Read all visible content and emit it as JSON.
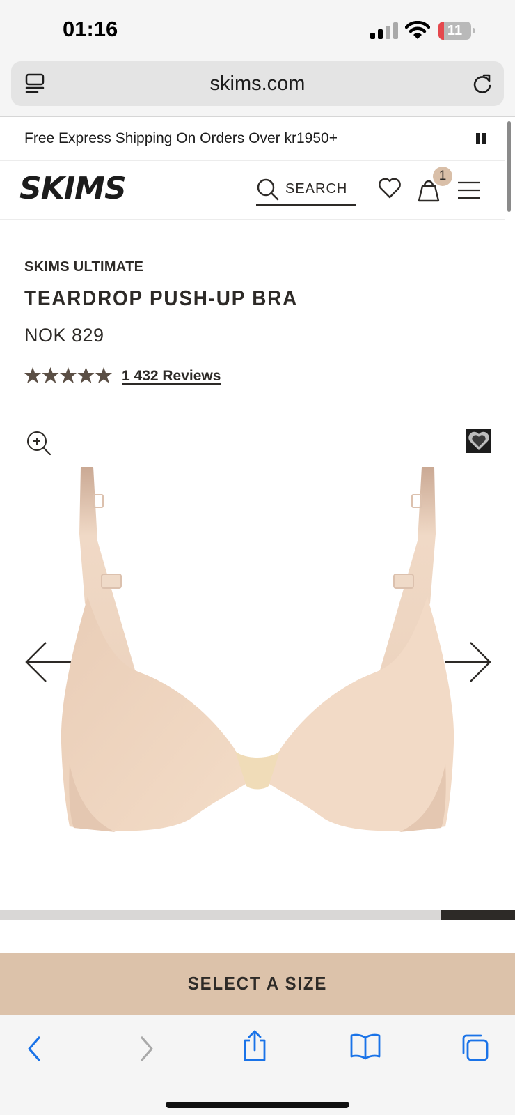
{
  "status_bar": {
    "time": "01:16",
    "battery": "11",
    "battery_level": 0.11
  },
  "browser": {
    "url": "skims.com"
  },
  "promo": {
    "text": "Free Express Shipping On Orders Over kr1950+"
  },
  "header": {
    "logo": "SKIMS",
    "search_label": "SEARCH",
    "cart_count": "1"
  },
  "product": {
    "collection": "SKIMS ULTIMATE",
    "title": "TEARDROP PUSH-UP BRA",
    "price": "NOK 829",
    "rating": 5,
    "reviews": "1 432 Reviews"
  },
  "gallery": {
    "image": "nude-push-up-bra",
    "progress_start": 0.857,
    "progress_end": 1.0
  },
  "cta": {
    "select_size": "SELECT A SIZE"
  },
  "colors": {
    "accent": "#dcc2aa",
    "text": "#2d2a27",
    "ios_blue": "#1a73e8"
  },
  "icons": {
    "toolbar": [
      "back-icon",
      "forward-icon",
      "share-icon",
      "bookmarks-icon",
      "tabs-icon"
    ]
  }
}
